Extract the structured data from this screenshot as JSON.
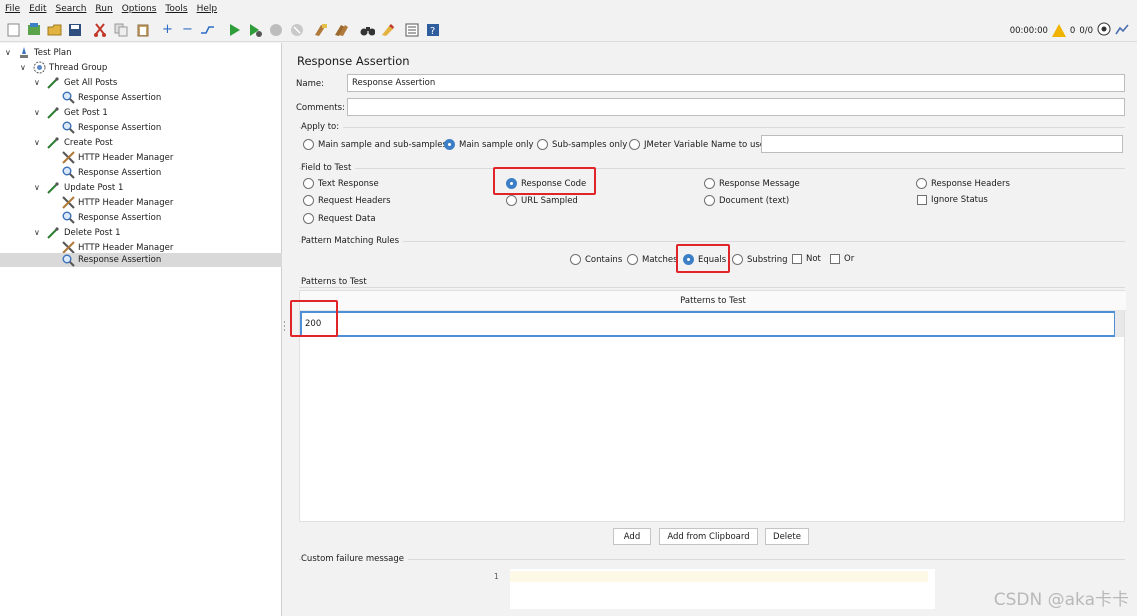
{
  "menu": [
    "File",
    "Edit",
    "Search",
    "Run",
    "Options",
    "Tools",
    "Help"
  ],
  "toolbar": {
    "timer": "00:00:00",
    "warning_count": "0",
    "thread_count": "0/0"
  },
  "tree": [
    {
      "label": "Test Plan",
      "icon": "test-plan-icon"
    },
    {
      "label": "Thread Group",
      "icon": "gear-icon"
    },
    {
      "label": "Get All Posts",
      "icon": "sampler-pipette-icon"
    },
    {
      "label": "Response Assertion",
      "icon": "magnifier-icon"
    },
    {
      "label": "Get Post 1",
      "icon": "sampler-pipette-icon"
    },
    {
      "label": "Response Assertion",
      "icon": "magnifier-icon"
    },
    {
      "label": "Create Post",
      "icon": "sampler-pipette-icon"
    },
    {
      "label": "HTTP Header Manager",
      "icon": "tools-icon"
    },
    {
      "label": "Response Assertion",
      "icon": "magnifier-icon"
    },
    {
      "label": "Update Post 1",
      "icon": "sampler-pipette-icon"
    },
    {
      "label": "HTTP Header Manager",
      "icon": "tools-icon"
    },
    {
      "label": "Response Assertion",
      "icon": "magnifier-icon"
    },
    {
      "label": "Delete Post 1",
      "icon": "sampler-pipette-icon"
    },
    {
      "label": "HTTP Header Manager",
      "icon": "tools-icon"
    },
    {
      "label": "Response Assertion",
      "icon": "magnifier-icon"
    }
  ],
  "panel": {
    "title": "Response Assertion",
    "name_label": "Name:",
    "name_value": "Response Assertion",
    "comments_label": "Comments:",
    "comments_value": "",
    "apply_to": {
      "label": "Apply to:",
      "options": [
        "Main sample and sub-samples",
        "Main sample only",
        "Sub-samples only",
        "JMeter Variable Name to use"
      ],
      "selected": "Main sample only",
      "variable_value": ""
    },
    "field_to_test": {
      "label": "Field to Test",
      "options": [
        "Text Response",
        "Response Code",
        "Response Message",
        "Response Headers",
        "Request Headers",
        "URL Sampled",
        "Document (text)",
        "Ignore Status",
        "Request Data"
      ],
      "selected": "Response Code"
    },
    "pattern_rules": {
      "label": "Pattern Matching Rules",
      "options": [
        "Contains",
        "Matches",
        "Equals",
        "Substring",
        "Not",
        "Or"
      ],
      "selected": "Equals"
    },
    "patterns": {
      "label": "Patterns to Test",
      "column_header": "Patterns to Test",
      "rows": [
        "200"
      ]
    },
    "buttons": {
      "add": "Add",
      "add_from_clipboard": "Add from Clipboard",
      "delete": "Delete"
    },
    "custom_failure": {
      "label": "Custom failure message",
      "line_number": "1"
    }
  },
  "watermark": "CSDN @aka卡卡",
  "colors": {
    "highlight": "#e0242a",
    "radio_selected": "#3d7fc6"
  }
}
